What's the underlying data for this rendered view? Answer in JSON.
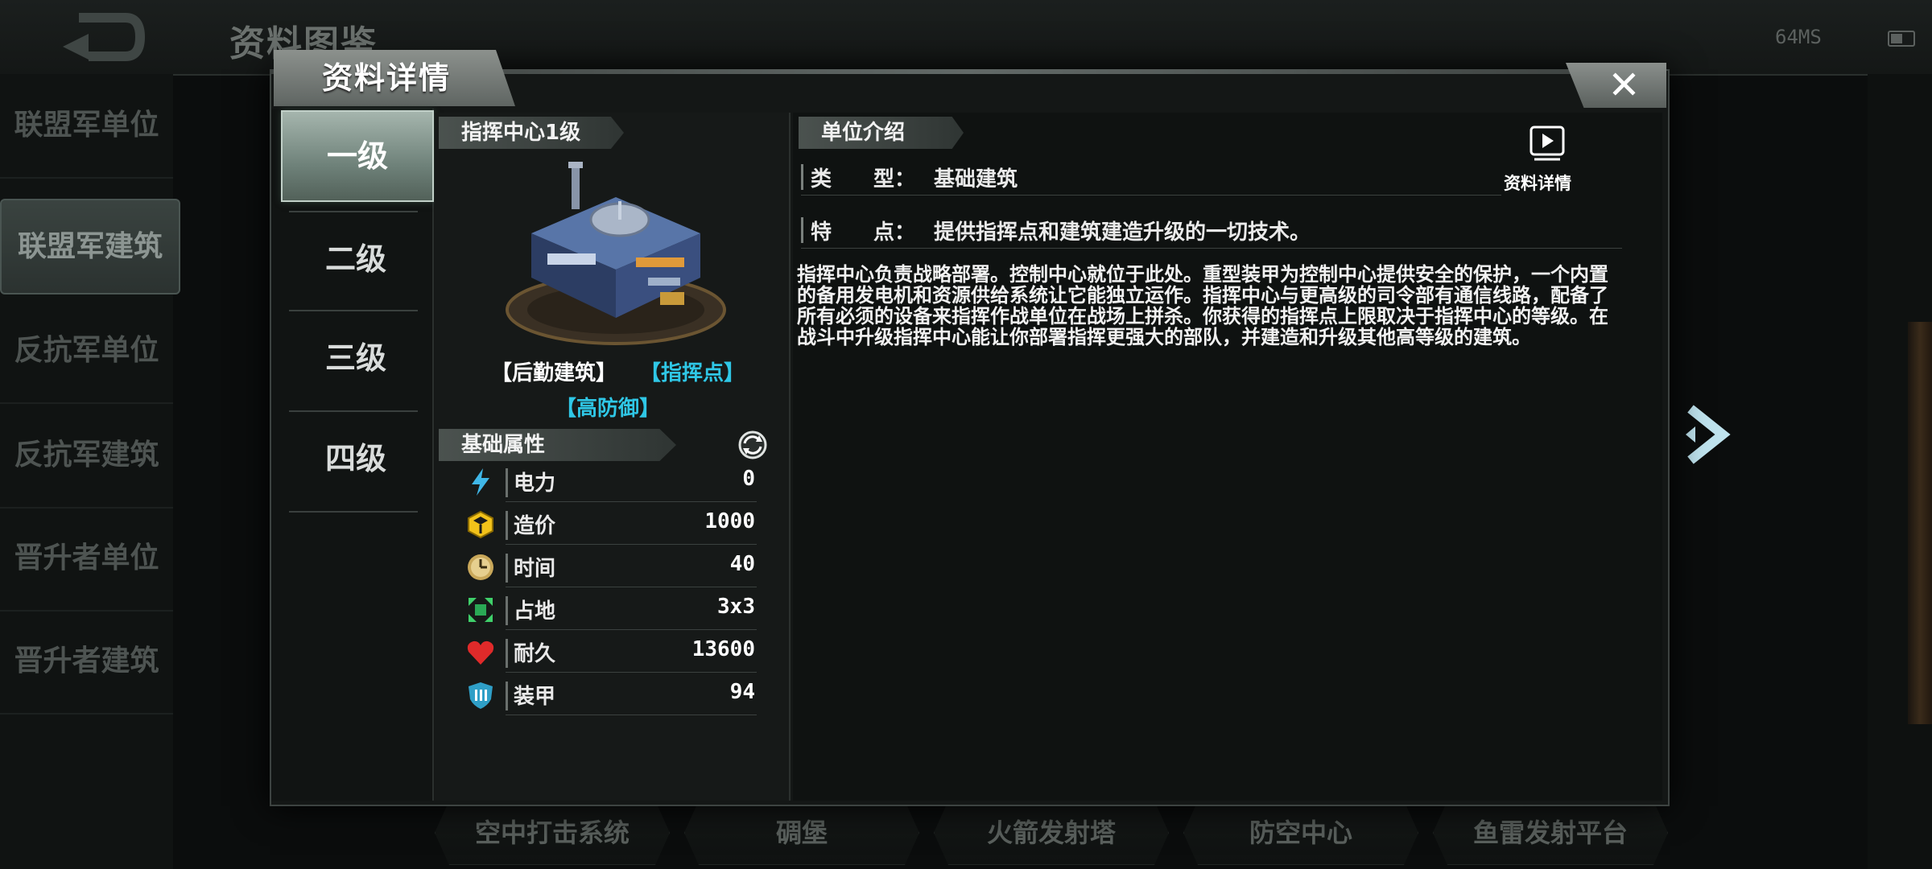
{
  "header": {
    "title": "资料图鉴",
    "status": "64MS"
  },
  "categories": [
    {
      "label": "联盟军单位",
      "selected": false
    },
    {
      "label": "联盟军建筑",
      "selected": true
    },
    {
      "label": "反抗军单位",
      "selected": false
    },
    {
      "label": "反抗军建筑",
      "selected": false
    },
    {
      "label": "晋升者单位",
      "selected": false
    },
    {
      "label": "晋升者建筑",
      "selected": false
    }
  ],
  "bottom_tabs": [
    "空中打击系统",
    "碉堡",
    "火箭发射塔",
    "防空中心",
    "鱼雷发射平台"
  ],
  "dialog": {
    "title": "资料详情",
    "close": "✕",
    "levels": [
      {
        "label": "一级",
        "selected": true
      },
      {
        "label": "二级",
        "selected": false
      },
      {
        "label": "三级",
        "selected": false
      },
      {
        "label": "四级",
        "selected": false
      }
    ],
    "unit": {
      "name": "指挥中心1级",
      "tags": [
        {
          "text": "【后勤建筑】",
          "color": "#ffffff"
        },
        {
          "text": "【指挥点】",
          "color": "#2fc7e6"
        },
        {
          "text": "【高防御】",
          "color": "#2fc7e6"
        }
      ],
      "attributes_title": "基础属性",
      "stats": [
        {
          "icon": "power-icon",
          "label": "电力",
          "value": "0"
        },
        {
          "icon": "cost-icon",
          "label": "造价",
          "value": "1000"
        },
        {
          "icon": "time-icon",
          "label": "时间",
          "value": "40"
        },
        {
          "icon": "footprint-icon",
          "label": "占地",
          "value": "3x3"
        },
        {
          "icon": "durability-icon",
          "label": "耐久",
          "value": "13600"
        },
        {
          "icon": "armor-icon",
          "label": "装甲",
          "value": "94"
        }
      ]
    },
    "intro": {
      "title": "单位介绍",
      "video_label": "资料详情",
      "type_key": "类　　型：",
      "type_value": "基础建筑",
      "feature_key": "特　　点：",
      "feature_value": "提供指挥点和建筑建造升级的一切技术。",
      "description": "指挥中心负责战略部署。控制中心就位于此处。重型装甲为控制中心提供安全的保护，一个内置的备用发电机和资源供给系统让它能独立运作。指挥中心与更高级的司令部有通信线路，配备了所有必须的设备来指挥作战单位在战场上拼杀。你获得的指挥点上限取决于指挥中心的等级。在战斗中升级指挥中心能让你部署指挥更强大的部队，并建造和升级其他高等级的建筑。"
    }
  }
}
